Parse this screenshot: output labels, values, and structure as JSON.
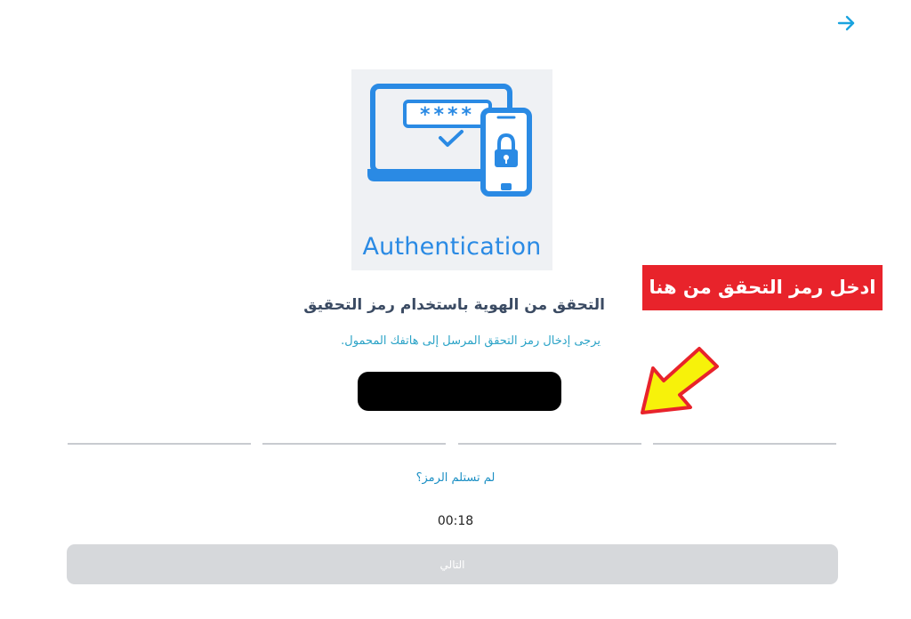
{
  "header": {
    "back_icon": "arrow-right-icon"
  },
  "illustration": {
    "caption": "Authentication",
    "masked_password": "****",
    "icons": [
      "laptop-icon",
      "smartphone-icon",
      "lock-icon",
      "checkmark-icon"
    ]
  },
  "content": {
    "title": "التحقق من الهوية باستخدام رمز التحقيق",
    "instruction": "يرجى إدخال رمز التحقق المرسل إلى هاتفك المحمول.",
    "otp_values": [
      "",
      "",
      "",
      ""
    ],
    "resend_link": "لم تستلم الرمز؟",
    "timer": "00:18",
    "next_button": "التالي"
  },
  "annotation": {
    "callout": "ادخل رمز التحقق من هنا"
  },
  "colors": {
    "accent_blue": "#2a8ae4",
    "link_blue": "#1b8fc4",
    "title": "#3b4b63",
    "disabled_button": "#d6d8db",
    "callout_red": "#e8232b",
    "arrow_yellow": "#f7f20a"
  }
}
